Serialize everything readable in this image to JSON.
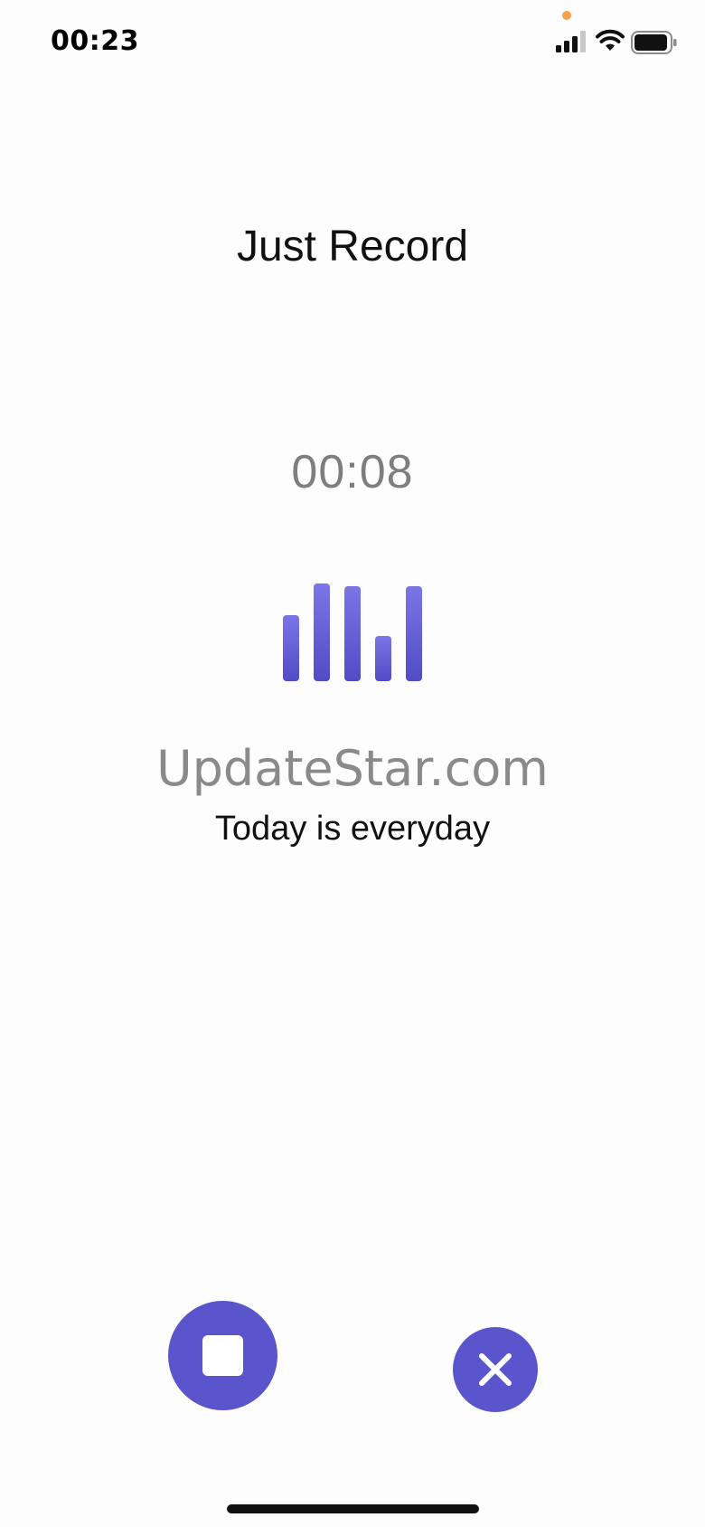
{
  "status_bar": {
    "time": "00:23",
    "icons": [
      "cellular-signal-icon",
      "wifi-icon",
      "battery-icon"
    ],
    "privacy_indicator_color": "#f5a04a"
  },
  "app": {
    "title": "Just Record"
  },
  "recorder": {
    "elapsed": "00:08",
    "level_meter_icon": "audio-level-bars-icon",
    "accent_color": "#5a55cd"
  },
  "watermark": {
    "text": "UpdateStar.com"
  },
  "subtitle": "Today is everyday",
  "controls": {
    "stop_icon": "stop-icon",
    "cancel_icon": "close-icon"
  }
}
